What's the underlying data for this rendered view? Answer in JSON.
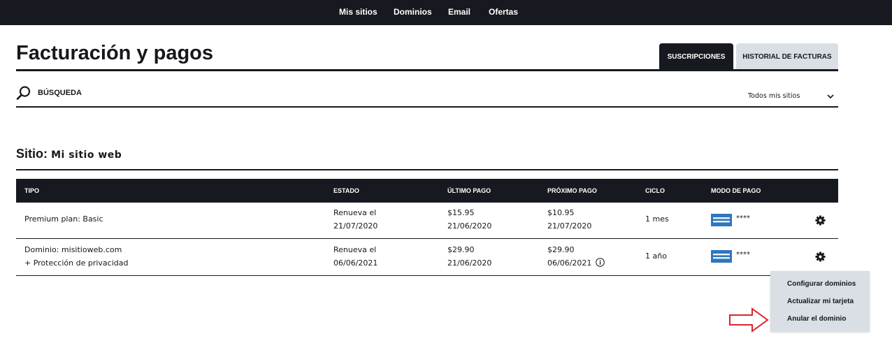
{
  "nav": {
    "items": [
      {
        "label": "Mis sitios"
      },
      {
        "label": "Dominios"
      },
      {
        "label": "Email"
      },
      {
        "label": "Ofertas"
      }
    ]
  },
  "page": {
    "title": "Facturación y pagos"
  },
  "tabs": {
    "active": "SUSCRIPCIONES",
    "inactive": "HISTORIAL DE FACTURAS"
  },
  "search": {
    "label": "BÚSQUEDA",
    "icon": "search-icon"
  },
  "site_filter": {
    "value": "Todos mis sitios",
    "icon": "chevron-down-icon"
  },
  "section": {
    "label": "Sitio:",
    "name": "Mi sitio web"
  },
  "table": {
    "columns": [
      "TIPO",
      "ESTADO",
      "ÚLTIMO PAGO",
      "PRÓXIMO PAGO",
      "CICLO",
      "MODO DE PAGO"
    ],
    "rows": [
      {
        "tipo_line1": "Premium plan: Basic",
        "tipo_line2": "",
        "estado_line1": "Renueva el",
        "estado_line2": "21/07/2020",
        "ultimo_amount": "$15.95",
        "ultimo_date": "21/06/2020",
        "proximo_amount": "$10.95",
        "proximo_date": "21/07/2020",
        "ciclo": "1 mes",
        "card_mask": "****"
      },
      {
        "tipo_line1": "Dominio:   misitioweb.com",
        "tipo_line2": "+ Protección de privacidad",
        "estado_line1": "Renueva el",
        "estado_line2": "06/06/2021",
        "ultimo_amount": "$29.90",
        "ultimo_date": "21/06/2020",
        "proximo_amount": "$29.90",
        "proximo_date": "06/06/2021",
        "ciclo": "1 año",
        "card_mask": "****"
      }
    ]
  },
  "menu": {
    "items": [
      {
        "label": "Configurar dominios"
      },
      {
        "label": "Actualizar mi tarjeta"
      },
      {
        "label": "Anular el dominio"
      }
    ]
  },
  "colors": {
    "dark": "#16191f",
    "tab_inactive": "#d9dfe5",
    "menu_bg": "#d9dfe5",
    "card_blue": "#2e77bc",
    "arrow_red": "#d9262c"
  }
}
